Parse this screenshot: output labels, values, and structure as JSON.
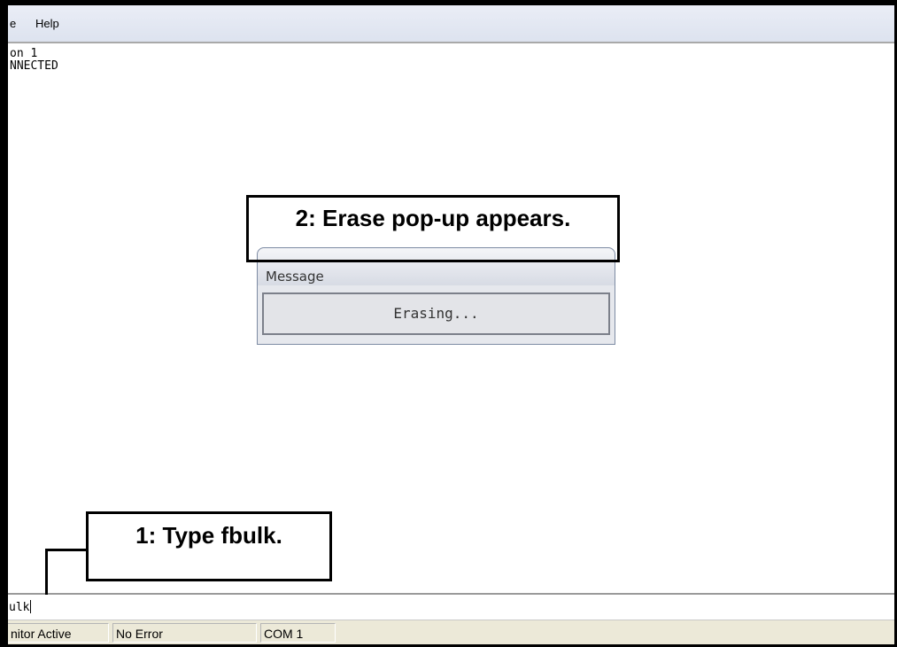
{
  "menubar": {
    "file_label": "e",
    "help_label": "Help"
  },
  "terminal": {
    "lines": [
      "on 1",
      "NNECTED"
    ]
  },
  "command": {
    "value": "ulk"
  },
  "statusbar": {
    "monitor": "nitor Active",
    "error": "No Error",
    "port": "COM 1"
  },
  "dialog": {
    "title": "Message",
    "text": "Erasing..."
  },
  "annotations": {
    "step2": "2: Erase pop-up appears.",
    "step1": "1: Type fbulk."
  }
}
